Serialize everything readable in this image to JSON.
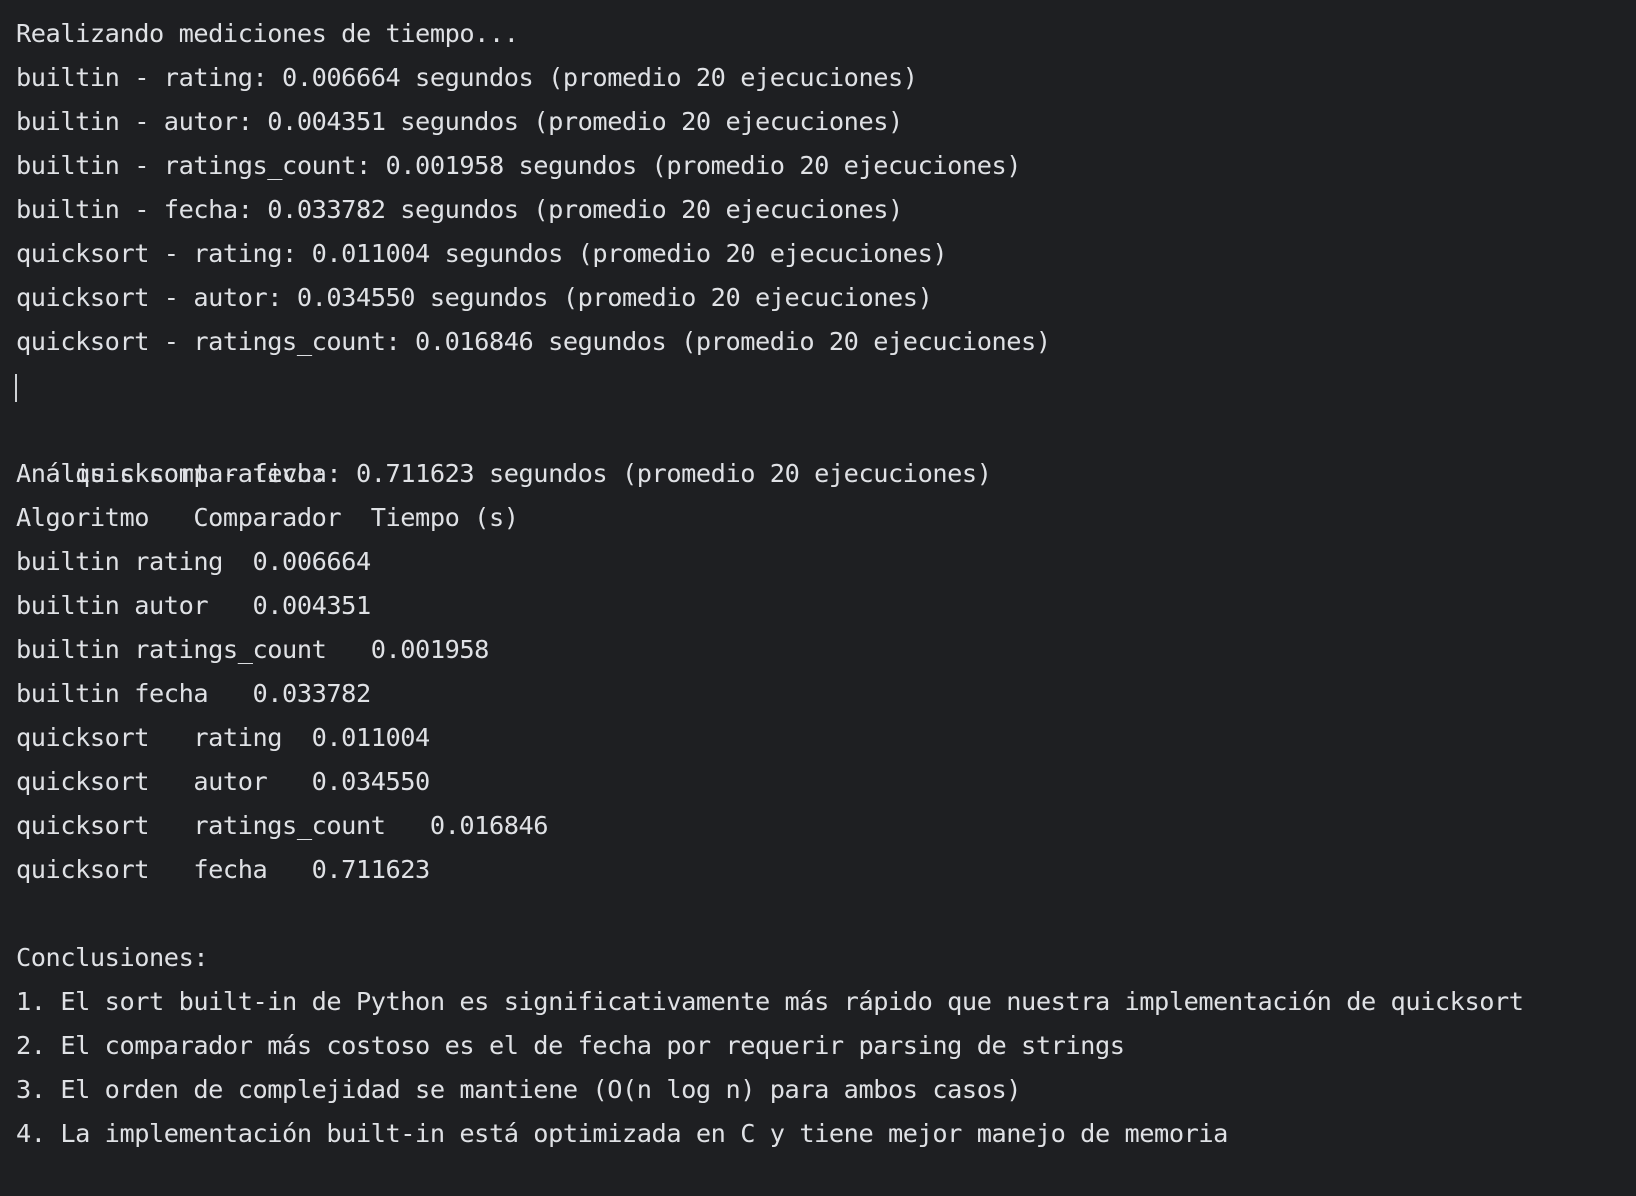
{
  "console": {
    "measure_header": "Realizando mediciones de tiempo...",
    "measurements": [
      "builtin - rating: 0.006664 segundos (promedio 20 ejecuciones)",
      "builtin - autor: 0.004351 segundos (promedio 20 ejecuciones)",
      "builtin - ratings_count: 0.001958 segundos (promedio 20 ejecuciones)",
      "builtin - fecha: 0.033782 segundos (promedio 20 ejecuciones)",
      "quicksort - rating: 0.011004 segundos (promedio 20 ejecuciones)",
      "quicksort - autor: 0.034550 segundos (promedio 20 ejecuciones)",
      "quicksort - ratings_count: 0.016846 segundos (promedio 20 ejecuciones)",
      "quicksort - fecha: 0.711623 segundos (promedio 20 ejecuciones)"
    ],
    "analysis_header": "Análisis comparativo:",
    "table_header": "Algoritmo   Comparador  Tiempo (s)",
    "table_rows": [
      "builtin rating  0.006664",
      "builtin autor   0.004351",
      "builtin ratings_count   0.001958",
      "builtin fecha   0.033782",
      "quicksort   rating  0.011004",
      "quicksort   autor   0.034550",
      "quicksort   ratings_count   0.016846",
      "quicksort   fecha   0.711623"
    ],
    "conclusions_header": "Conclusiones:",
    "conclusions": [
      "1. El sort built-in de Python es significativamente más rápido que nuestra implementación de quicksort",
      "2. El comparador más costoso es el de fecha por requerir parsing de strings",
      "3. El orden de complejidad se mantiene (O(n log n) para ambos casos)",
      "4. La implementación built-in está optimizada en C y tiene mejor manejo de memoria"
    ]
  }
}
